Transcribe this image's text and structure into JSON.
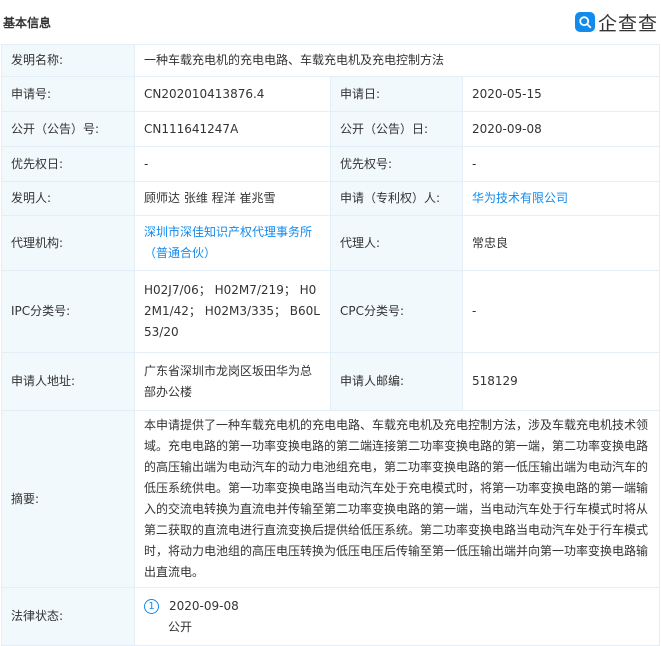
{
  "header": {
    "title": "基本信息",
    "logo_text": "企查查",
    "logo_color": "#128bed"
  },
  "fields": {
    "invention_name": {
      "label": "发明名称:",
      "value": "一种车载充电机的充电电路、车载充电机及充电控制方法"
    },
    "application_no": {
      "label": "申请号:",
      "value": "CN202010413876.4"
    },
    "application_date": {
      "label": "申请日:",
      "value": "2020-05-15"
    },
    "publication_no": {
      "label": "公开（公告）号:",
      "value": "CN111641247A"
    },
    "publication_date": {
      "label": "公开（公告）日:",
      "value": "2020-09-08"
    },
    "priority_date": {
      "label": "优先权日:",
      "value": "-"
    },
    "priority_no": {
      "label": "优先权号:",
      "value": "-"
    },
    "inventors": {
      "label": "发明人:",
      "value": "顾师达 张维 程洋 崔兆雪"
    },
    "applicant": {
      "label": "申请（专利权）人:",
      "value": "华为技术有限公司"
    },
    "agency": {
      "label": "代理机构:",
      "value": "深圳市深佳知识产权代理事务所（普通合伙）"
    },
    "agent": {
      "label": "代理人:",
      "value": "常忠良"
    },
    "ipc": {
      "label": "IPC分类号:",
      "value": "H02J7/06； H02M7/219； H02M1/42； H02M3/335； B60L53/20"
    },
    "cpc": {
      "label": "CPC分类号:",
      "value": "-"
    },
    "address": {
      "label": "申请人地址:",
      "value": "广东省深圳市龙岗区坂田华为总部办公楼"
    },
    "postcode": {
      "label": "申请人邮编:",
      "value": "518129"
    },
    "abstract": {
      "label": "摘要:",
      "value": "本申请提供了一种车载充电机的充电电路、车载充电机及充电控制方法，涉及车载充电机技术领域。充电电路的第一功率变换电路的第二端连接第二功率变换电路的第一端，第二功率变换电路的高压输出端为电动汽车的动力电池组充电，第二功率变换电路的第一低压输出端为电动汽车的低压系统供电。第一功率变换电路当电动汽车处于充电模式时，将第一功率变换电路的第一端输入的交流电转换为直流电并传输至第二功率变换电路的第一端，当电动汽车处于行车模式时将从第二获取的直流电进行直流变换后提供给低压系统。第二功率变换电路当电动汽车处于行车模式时，将动力电池组的高压电压转换为低压电压后传输至第一低压输出端并向第一功率变换电路输出直流电。"
    },
    "legal_status": {
      "label": "法律状态:",
      "index": "1",
      "date": "2020-09-08",
      "status": "公开"
    }
  }
}
